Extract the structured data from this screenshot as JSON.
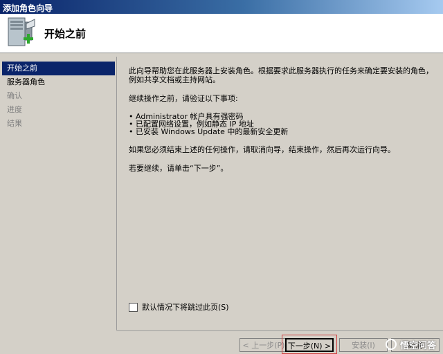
{
  "window": {
    "title": "添加角色向导"
  },
  "header": {
    "page_title": "开始之前"
  },
  "sidebar": {
    "items": [
      {
        "label": "开始之前",
        "state": "active"
      },
      {
        "label": "服务器角色",
        "state": "normal"
      },
      {
        "label": "确认",
        "state": "disabled"
      },
      {
        "label": "进度",
        "state": "disabled"
      },
      {
        "label": "结果",
        "state": "disabled"
      }
    ]
  },
  "content": {
    "intro": "此向导帮助您在此服务器上安装角色。根据要求此服务器执行的任务来确定要安装的角色，例如共享文档或主持网站。",
    "checklist_heading": "继续操作之前，请验证以下事项:",
    "checklist": [
      "Administrator 帐户具有强密码",
      "已配置网络设置，例如静态 IP 地址",
      "已安装 Windows Update 中的最新安全更新"
    ],
    "cancel_note": "如果您必须结束上述的任何操作，请取消向导，结束操作，然后再次运行向导。",
    "continue_note": "若要继续，请单击“下一步”。"
  },
  "skip_option": {
    "label": "默认情况下将跳过此页(S)",
    "checked": false
  },
  "buttons": {
    "prev": "< 上一步(P)",
    "next": "下一步(N) >",
    "install": "安装(I)",
    "cancel": "取消"
  },
  "watermark": {
    "text": "悟空问答"
  }
}
